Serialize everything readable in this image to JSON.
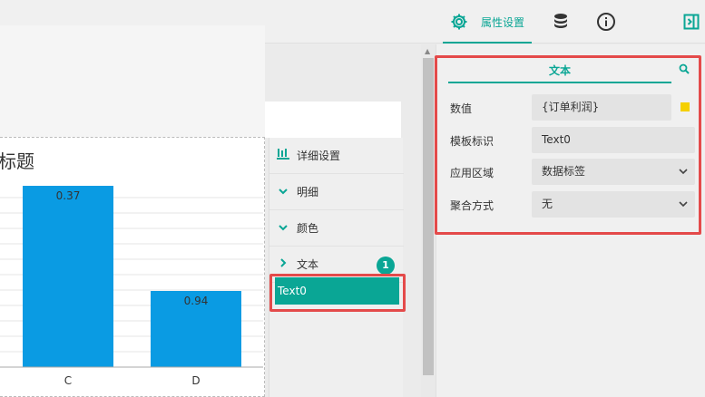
{
  "toolbar": {
    "props_tab_label": "属性设置",
    "props_icon": "gear-icon",
    "db_icon": "database-icon",
    "info_icon": "info-icon",
    "collapse_icon": "panel-collapse-icon",
    "accent": "#0aa695"
  },
  "chart": {
    "title": "标题"
  },
  "chart_data": {
    "type": "bar",
    "categories": [
      "C",
      "D"
    ],
    "values": [
      0.37,
      0.94
    ],
    "title": "标题",
    "bar_color": "#0a9be3"
  },
  "detail_panel": {
    "header_label": "详细设置",
    "items": [
      {
        "label": "明细",
        "icon": "chevron-down-icon"
      },
      {
        "label": "颜色",
        "icon": "chevron-down-icon"
      },
      {
        "label": "文本",
        "icon": "chevron-right-icon",
        "badge": "1"
      }
    ],
    "selected_item": "Text0"
  },
  "props_panel": {
    "section_tab": "文本",
    "fields": [
      {
        "label": "数值",
        "value": "{订单利润}",
        "swatch": "#f5d000"
      },
      {
        "label": "模板标识",
        "value": "Text0"
      },
      {
        "label": "应用区域",
        "value": "数据标签",
        "dropdown": true
      },
      {
        "label": "聚合方式",
        "value": "无",
        "dropdown": true
      }
    ]
  }
}
